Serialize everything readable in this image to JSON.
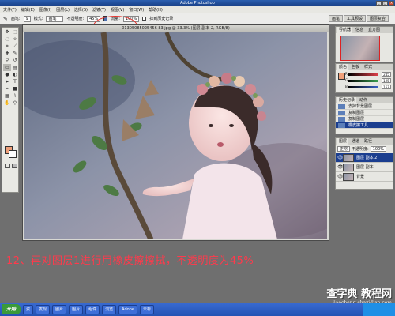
{
  "window": {
    "title": "Adobe Photoshop",
    "buttons": [
      "_",
      "□",
      "×"
    ]
  },
  "menubar": {
    "items": [
      "文件(F)",
      "编辑(E)",
      "图像(I)",
      "图层(L)",
      "选择(S)",
      "滤镜(T)",
      "视图(V)",
      "窗口(W)",
      "帮助(H)"
    ]
  },
  "options": {
    "brush_label": "画笔:",
    "brush_size": "9",
    "mode_label": "模式:",
    "mode_value": "画笔",
    "opacity_label": "不透明度:",
    "opacity_value": "45%",
    "flow_label": "流量:",
    "flow_value": "100%",
    "history_checkbox": "抹到历史记录",
    "dock_tabs": [
      "画笔",
      "工具预设",
      "图层复合"
    ]
  },
  "document": {
    "title": "01305085025456 83.jpg @ 33.3% (图层 副本 2, RGB/8)"
  },
  "panels": {
    "navigator": {
      "tabs": [
        "导航器",
        "信息",
        "直方图"
      ]
    },
    "color": {
      "tabs": [
        "颜色",
        "色板",
        "样式"
      ],
      "channels": [
        {
          "label": "R",
          "value": "245",
          "color": "#e0404a"
        },
        {
          "label": "G",
          "value": "195",
          "color": "#3ca050"
        },
        {
          "label": "B",
          "value": "157",
          "color": "#3a63c8"
        }
      ]
    },
    "history": {
      "tabs": [
        "历史记录",
        "动作"
      ],
      "items": [
        "去掉背景图层",
        "复制图层",
        "复制图层",
        "橡皮擦工具"
      ]
    },
    "layers": {
      "tabs": [
        "图层",
        "通道",
        "路径"
      ],
      "blend_mode": "正常",
      "opacity_label": "不透明度:",
      "opacity_value": "100%",
      "rows": [
        {
          "name": "图层 副本 2",
          "selected": true
        },
        {
          "name": "图层 副本",
          "selected": false
        },
        {
          "name": "背景",
          "selected": false
        }
      ]
    }
  },
  "caption": "12、再对图层1进行用橡皮擦擦拭，不透明度为45%",
  "taskbar": {
    "start": "开始",
    "items": [
      "资",
      "发现",
      "图片",
      "图片",
      "组件",
      "浏览",
      "Adobe",
      "未标"
    ]
  },
  "watermark": {
    "big": "查字典 教程网",
    "small": "jiaocheng.chazidian.com"
  }
}
